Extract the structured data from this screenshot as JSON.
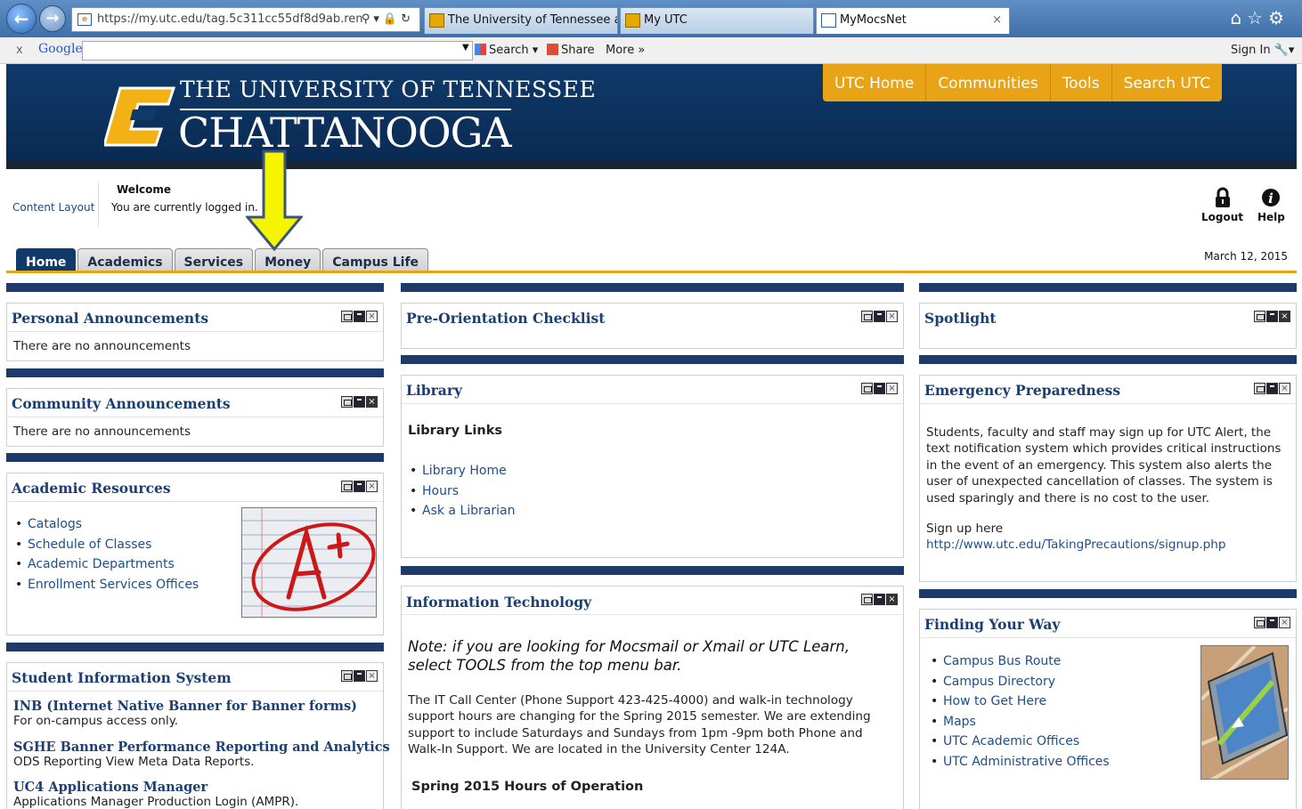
{
  "browser": {
    "url": "https://my.utc.edu/tag.5c311cc55df8d9ab.ren",
    "tabs": [
      {
        "label": "The University of Tennessee at ..."
      },
      {
        "label": "My UTC"
      },
      {
        "label": "MyMocsNet"
      }
    ],
    "tab_close": "×"
  },
  "google_toolbar": {
    "close": "x",
    "logo": "Google",
    "search": "Search",
    "share": "Share",
    "more": "More »",
    "sign_in": "Sign In"
  },
  "header": {
    "logo_line1": "THE UNIVERSITY OF TENNESSEE",
    "logo_line2": "CHATTANOOGA",
    "menu": [
      "UTC Home",
      "Communities",
      "Tools",
      "Search UTC"
    ],
    "colors": {
      "navy": "#0f3a6a",
      "gold": "#e8a317"
    }
  },
  "welcome": {
    "content_layout": "Content Layout",
    "title": "Welcome",
    "status": "You are currently logged in.",
    "logout": "Logout",
    "help": "Help",
    "date": "March 12, 2015"
  },
  "tabs": [
    "Home",
    "Academics",
    "Services",
    "Money",
    "Campus Life"
  ],
  "left": {
    "personal": {
      "title": "Personal Announcements",
      "text": "There are no announcements"
    },
    "community": {
      "title": "Community Announcements",
      "text": "There are no announcements"
    },
    "academic": {
      "title": "Academic Resources",
      "links": [
        "Catalogs",
        "Schedule of Classes",
        "Academic Departments",
        "Enrollment Services Offices"
      ]
    },
    "sis": {
      "title": "Student Information System",
      "items": [
        {
          "title": "INB (Internet Native Banner for Banner forms)",
          "sub": "For on-campus access only."
        },
        {
          "title": "SGHE Banner Performance Reporting and Analytics",
          "sub": "ODS Reporting View Meta Data Reports."
        },
        {
          "title": "UC4 Applications Manager",
          "sub": "Applications Manager Production Login (AMPR)."
        }
      ]
    }
  },
  "middle": {
    "checklist": {
      "title": "Pre-Orientation Checklist"
    },
    "library": {
      "title": "Library",
      "heading": "Library Links",
      "links": [
        "Library Home",
        "Hours",
        "Ask a Librarian"
      ]
    },
    "it": {
      "title": "Information Technology",
      "note": "Note: if you are looking for Mocsmail or Xmail or UTC Learn, select TOOLS from the top menu bar.",
      "body": "The IT Call Center (Phone Support 423-425-4000) and walk-in technology support hours are changing for the Spring 2015 semester. We are extending support to include Saturdays and Sundays from 1pm -9pm both Phone and Walk-In Support. We are located in the University Center 124A.",
      "hours_heading": "Spring 2015 Hours of Operation"
    }
  },
  "right": {
    "spotlight": {
      "title": "Spotlight"
    },
    "emergency": {
      "title": "Emergency Preparedness",
      "body": "Students, faculty and staff may sign up for UTC Alert, the text notification system which provides critical instructions in the event of an emergency.  This system also alerts the user of unexpected cancellation of classes.  The system is used sparingly and there is no cost to the user.",
      "signup": "Sign up here",
      "signup_url": "http://www.utc.edu/TakingPrecautions/signup.php"
    },
    "finding": {
      "title": "Finding Your Way",
      "links": [
        "Campus Bus Route",
        "Campus Directory",
        "How to Get Here",
        "Maps",
        "UTC Academic Offices",
        "UTC Administrative Offices"
      ]
    }
  },
  "icons": {
    "arrow": "yellow-down-arrow",
    "logout": "lock-icon",
    "help": "info-icon"
  }
}
